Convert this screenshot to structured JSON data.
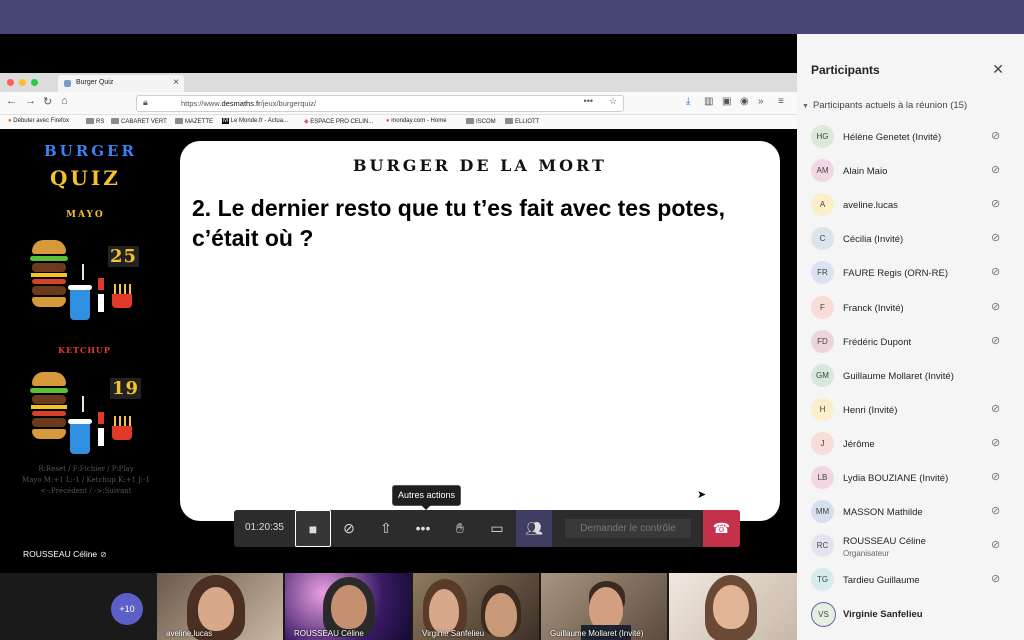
{
  "browser": {
    "tab_title": "Burger Quiz",
    "url_prefix": "https://www.",
    "url_domain": "desmaths.fr",
    "url_path": "/jeux/burgerquiz/",
    "bookmarks": [
      "Débuter avec Firefox",
      "RS",
      "CABARET VERT",
      "MAZETTE",
      "Le Monde.fr - Actua...",
      "ESPACE PRO CELIN...",
      "monday.com - Home",
      "ISCOM",
      "ELLIOTT"
    ]
  },
  "game": {
    "logo_line1": "BURGER",
    "logo_line2": "QUIZ",
    "left_label_1": "MAYO",
    "left_score_1": "25",
    "left_label_2": "KETCHUP",
    "left_score_2": "19",
    "help_line1": "R:Reset / F:Fichier / P:Play",
    "help_line2": "Mayo M:+1 L:-1 / Ketchup K:+1 J:-1",
    "help_line3": "<-:Précédent / ->:Suivant",
    "card_heading": "BURGER DE LA MORT",
    "question": "2. Le dernier resto que tu t’es fait avec tes potes, c’était où ?"
  },
  "meeting": {
    "tooltip": "Autres actions",
    "timer": "01:20:35",
    "request_control": "Demander le contrôle",
    "presenter_name": "ROUSSEAU Céline",
    "overflow_count": "+10",
    "thumbnails": [
      {
        "name": "aveline.lucas"
      },
      {
        "name": "ROUSSEAU Céline"
      },
      {
        "name": "Virginie Sanfelieu"
      },
      {
        "name": "Guillaume Mollaret (Invité)"
      },
      {
        "name": ""
      }
    ]
  },
  "panel": {
    "title": "Participants",
    "section": "Participants actuels à la réunion (15)",
    "participants": [
      {
        "initials": "HG",
        "name": "Hélène Genetet (Invité)",
        "color": "#dce8d8",
        "muted": true
      },
      {
        "initials": "AM",
        "name": "Alain Maio",
        "color": "#f2d6e4",
        "muted": true
      },
      {
        "initials": "A",
        "name": "aveline.lucas",
        "color": "#fbeec8",
        "muted": true
      },
      {
        "initials": "C",
        "name": "Cécilia (Invité)",
        "color": "#dbe4ea",
        "muted": true
      },
      {
        "initials": "FR",
        "name": "FAURE Regis (ORN-RE)",
        "color": "#dbe2ef",
        "muted": true
      },
      {
        "initials": "F",
        "name": "Franck (Invité)",
        "color": "#f7dcd8",
        "muted": true
      },
      {
        "initials": "FD",
        "name": "Frédéric Dupont",
        "color": "#ecd6da",
        "muted": true
      },
      {
        "initials": "GM",
        "name": "Guillaume Mollaret (Invité)",
        "color": "#d6e8dc",
        "muted": false
      },
      {
        "initials": "H",
        "name": "Henri (Invité)",
        "color": "#fbeec8",
        "muted": true
      },
      {
        "initials": "J",
        "name": "Jérôme",
        "color": "#f7dcd8",
        "muted": true
      },
      {
        "initials": "LB",
        "name": "Lydia BOUZIANE (Invité)",
        "color": "#f2d6e4",
        "muted": true
      },
      {
        "initials": "MM",
        "name": "MASSON Mathilde",
        "color": "#d6dfee",
        "muted": true
      },
      {
        "initials": "RC",
        "name": "ROUSSEAU Céline",
        "role": "Organisateur",
        "color": "#e4e4f0",
        "muted": true
      },
      {
        "initials": "TG",
        "name": "Tardieu Guillaume",
        "color": "#d6ecec",
        "muted": true
      },
      {
        "initials": "VS",
        "name": "Virginie Sanfelieu",
        "color": "#e6eedf",
        "muted": false,
        "bold": true
      }
    ]
  }
}
